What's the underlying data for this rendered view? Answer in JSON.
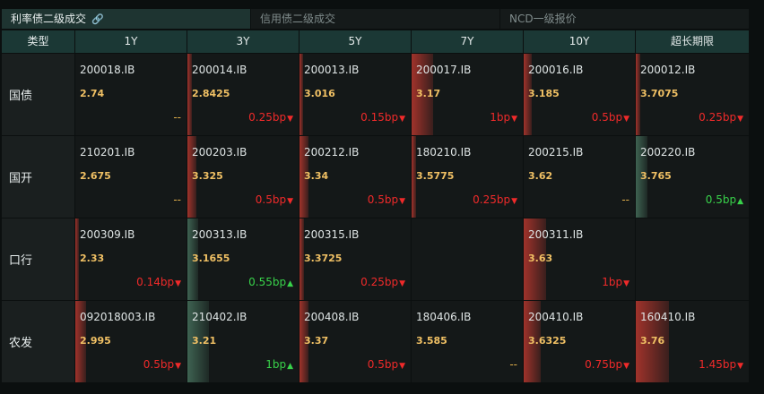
{
  "tabs": [
    {
      "label": "利率债二级成交",
      "active": true,
      "link_icon": "🔗"
    },
    {
      "label": "信用债二级成交",
      "active": false
    },
    {
      "label": "NCD一级报价",
      "active": false
    }
  ],
  "columns": [
    "类型",
    "1Y",
    "3Y",
    "5Y",
    "7Y",
    "10Y",
    "超长期限"
  ],
  "colors": {
    "down": "#f02a2a",
    "up": "#38d24a",
    "price": "#f0c064",
    "header": "#1b3835"
  },
  "rows": [
    {
      "type": "国债",
      "cells": [
        {
          "code": "200018.IB",
          "price": "2.74",
          "change": "--",
          "dir": "flat",
          "bar": "none",
          "level": 0
        },
        {
          "code": "200014.IB",
          "price": "2.8425",
          "change": "0.25bp",
          "dir": "down",
          "bar": "red",
          "level": 0.04
        },
        {
          "code": "200013.IB",
          "price": "3.016",
          "change": "0.15bp",
          "dir": "down",
          "bar": "red",
          "level": 0.03
        },
        {
          "code": "200017.IB",
          "price": "3.17",
          "change": "1bp",
          "dir": "down",
          "bar": "red",
          "level": 0.19
        },
        {
          "code": "200016.IB",
          "price": "3.185",
          "change": "0.5bp",
          "dir": "down",
          "bar": "red",
          "level": 0.07
        },
        {
          "code": "200012.IB",
          "price": "3.7075",
          "change": "0.25bp",
          "dir": "down",
          "bar": "red",
          "level": 0.04
        }
      ]
    },
    {
      "type": "国开",
      "cells": [
        {
          "code": "210201.IB",
          "price": "2.675",
          "change": "--",
          "dir": "flat",
          "bar": "none",
          "level": 0
        },
        {
          "code": "200203.IB",
          "price": "3.325",
          "change": "0.5bp",
          "dir": "down",
          "bar": "red",
          "level": 0.08
        },
        {
          "code": "200212.IB",
          "price": "3.34",
          "change": "0.5bp",
          "dir": "down",
          "bar": "red",
          "level": 0.08
        },
        {
          "code": "180210.IB",
          "price": "3.5775",
          "change": "0.25bp",
          "dir": "down",
          "bar": "red",
          "level": 0.04
        },
        {
          "code": "200215.IB",
          "price": "3.62",
          "change": "--",
          "dir": "flat",
          "bar": "none",
          "level": 0
        },
        {
          "code": "200220.IB",
          "price": "3.765",
          "change": "0.5bp",
          "dir": "up",
          "bar": "green",
          "level": 0.1
        }
      ]
    },
    {
      "type": "口行",
      "cells": [
        {
          "code": "200309.IB",
          "price": "2.33",
          "change": "0.14bp",
          "dir": "down",
          "bar": "red",
          "level": 0.03
        },
        {
          "code": "200313.IB",
          "price": "3.1655",
          "change": "0.55bp",
          "dir": "up",
          "bar": "green",
          "level": 0.1
        },
        {
          "code": "200315.IB",
          "price": "3.3725",
          "change": "0.25bp",
          "dir": "down",
          "bar": "red",
          "level": 0.04
        },
        null,
        {
          "code": "200311.IB",
          "price": "3.63",
          "change": "1bp",
          "dir": "down",
          "bar": "red",
          "level": 0.2
        },
        null
      ]
    },
    {
      "type": "农发",
      "cells": [
        {
          "code": "092018003.IB",
          "price": "2.995",
          "change": "0.5bp",
          "dir": "down",
          "bar": "red",
          "level": 0.1
        },
        {
          "code": "210402.IB",
          "price": "3.21",
          "change": "1bp",
          "dir": "up",
          "bar": "green",
          "level": 0.19
        },
        {
          "code": "200408.IB",
          "price": "3.37",
          "change": "0.5bp",
          "dir": "down",
          "bar": "red",
          "level": 0.08
        },
        {
          "code": "180406.IB",
          "price": "3.585",
          "change": "--",
          "dir": "flat",
          "bar": "none",
          "level": 0
        },
        {
          "code": "200410.IB",
          "price": "3.6325",
          "change": "0.75bp",
          "dir": "down",
          "bar": "red",
          "level": 0.15
        },
        {
          "code": "160410.IB",
          "price": "3.76",
          "change": "1.45bp",
          "dir": "down",
          "bar": "red",
          "level": 0.29
        }
      ]
    }
  ]
}
